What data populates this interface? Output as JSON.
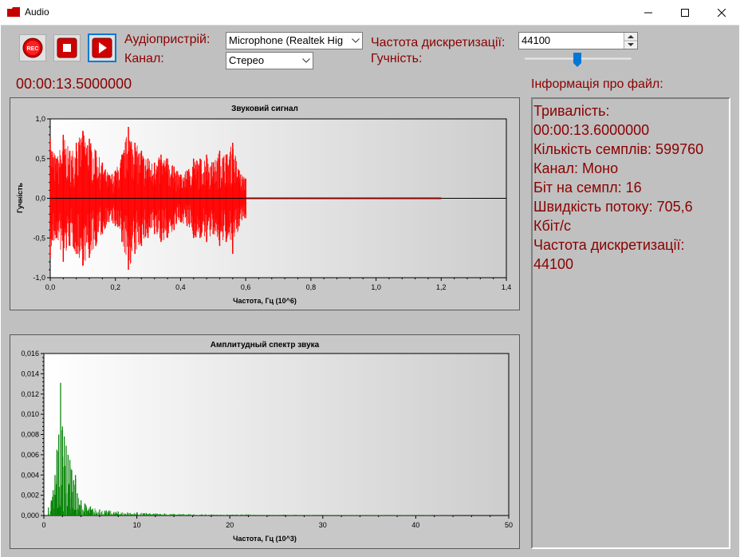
{
  "window": {
    "title": "Audio",
    "accent": "#c40000"
  },
  "toolbar": {
    "rec_label": "REC",
    "audio_device_label": "Аудіопристрій:",
    "channel_label": "Канал:",
    "audio_device_value": "Microphone (Realtek Hig",
    "channel_value": "Стерео",
    "sample_rate_label": "Частота дискретизації:",
    "sample_rate_value": "44100",
    "volume_label": "Гучність:",
    "volume_level": 0.49
  },
  "timer": "00:00:13.5000000",
  "file_info": {
    "header": "Інформація про файл:",
    "lines": [
      "Тривалість:",
      "00:00:13.6000000",
      "Кількість семплів: 599760",
      "Канал: Моно",
      "Біт на семпл: 16",
      "Швидкість потоку: 705,6",
      "Кбіт/с",
      "Частота дискретизації:",
      "44100"
    ]
  },
  "chart_data": [
    {
      "type": "area",
      "title": "Звуковий сигнал",
      "xlabel": "Частота, Гц (10^6)",
      "ylabel": "Гучність",
      "xlim": [
        0,
        1.4
      ],
      "ylim": [
        -1.0,
        1.0
      ],
      "x_ticks": [
        "0,0",
        "0,2",
        "0,4",
        "0,6",
        "0,8",
        "1,0",
        "1,2",
        "1,4"
      ],
      "y_ticks": [
        "1,0",
        "0,5",
        "0,0",
        "-0,5",
        "-1,0"
      ],
      "signal_end": 0.6,
      "flat_end": 1.2,
      "series": [
        {
          "color": "#ff0000",
          "x": [
            0.0,
            0.02,
            0.04,
            0.06,
            0.08,
            0.1,
            0.12,
            0.14,
            0.16,
            0.18,
            0.2,
            0.22,
            0.24,
            0.26,
            0.28,
            0.3,
            0.32,
            0.34,
            0.36,
            0.38,
            0.4,
            0.42,
            0.44,
            0.46,
            0.48,
            0.5,
            0.52,
            0.54,
            0.56,
            0.58,
            0.6
          ],
          "values": [
            0.75,
            0.5,
            0.8,
            0.6,
            0.7,
            0.85,
            0.75,
            0.6,
            0.45,
            0.3,
            0.35,
            0.55,
            0.9,
            0.7,
            0.6,
            0.5,
            0.45,
            0.55,
            0.5,
            0.4,
            0.3,
            0.35,
            0.5,
            0.5,
            0.55,
            0.45,
            0.6,
            0.55,
            0.7,
            0.35,
            0.25
          ]
        }
      ]
    },
    {
      "type": "bar",
      "title": "Амплитудный спектр звука",
      "xlabel": "Частота, Гц (10^3)",
      "ylabel": "",
      "xlim": [
        0,
        50
      ],
      "ylim": [
        0,
        0.016
      ],
      "x_ticks": [
        "0",
        "10",
        "20",
        "30",
        "40",
        "50"
      ],
      "y_ticks": [
        "0,016",
        "0,014",
        "0,012",
        "0,010",
        "0,008",
        "0,006",
        "0,004",
        "0,002",
        "0,000"
      ],
      "series": [
        {
          "color": "#008000",
          "x": [
            0.5,
            0.8,
            1.0,
            1.2,
            1.4,
            1.6,
            1.8,
            2.0,
            2.2,
            2.4,
            2.6,
            2.8,
            3.0,
            3.2,
            3.4,
            3.6,
            4.0,
            4.4,
            5.0,
            6.0,
            7.0,
            8.0,
            9.0,
            10.0,
            11.0,
            12.0,
            13.0,
            15.0,
            18.0,
            22.0,
            26.0,
            30.0,
            35.0,
            40.0,
            44.0
          ],
          "values": [
            0.0008,
            0.0015,
            0.0025,
            0.004,
            0.0065,
            0.008,
            0.0131,
            0.0088,
            0.0078,
            0.0069,
            0.006,
            0.0055,
            0.0045,
            0.0035,
            0.004,
            0.0022,
            0.0015,
            0.0012,
            0.0009,
            0.0006,
            0.0005,
            0.0004,
            0.0003,
            0.0003,
            0.00025,
            0.0002,
            0.0002,
            0.00015,
            0.0001,
            0.0001,
            8e-05,
            6e-05,
            5e-05,
            4e-05,
            3e-05
          ]
        }
      ]
    }
  ]
}
